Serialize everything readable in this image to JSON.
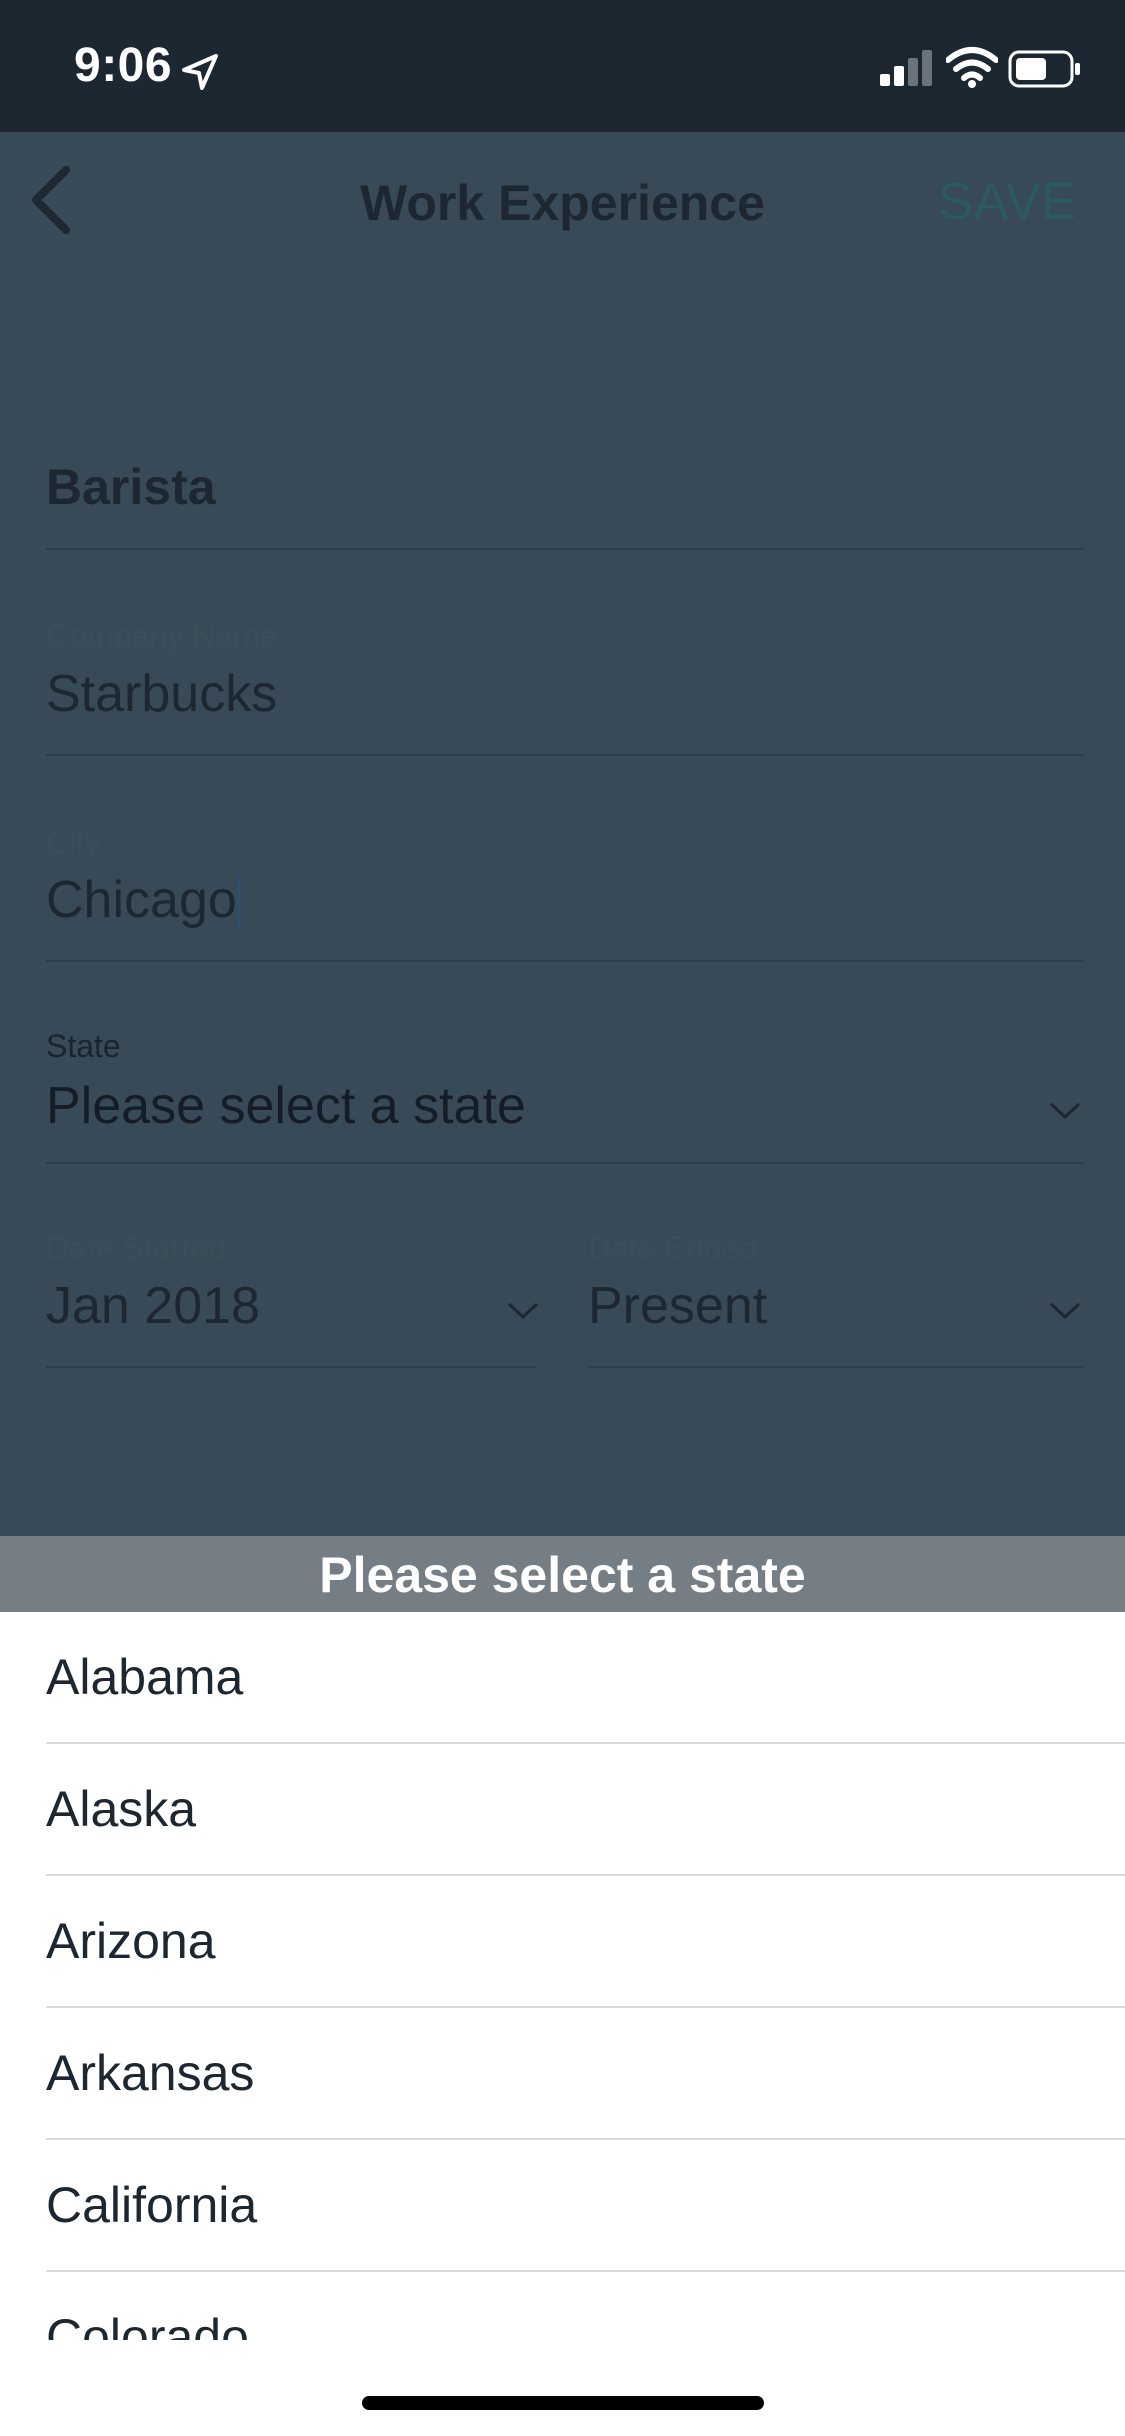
{
  "status_bar": {
    "time": "9:06"
  },
  "header": {
    "title": "Work Experience",
    "save_label": "SAVE"
  },
  "form": {
    "job_title": "Barista",
    "company_label": "Company Name",
    "company_value": "Starbucks",
    "city_label": "City",
    "city_value": "Chicago",
    "state_label": "State",
    "state_value": "Please select a state",
    "date_started_label": "Date Started",
    "date_started_value": "Jan 2018",
    "date_ended_label": "Date Ended",
    "date_ended_value": "Present"
  },
  "picker": {
    "title": "Please select a state",
    "options": [
      "Alabama",
      "Alaska",
      "Arizona",
      "Arkansas",
      "California",
      "Colorado"
    ]
  },
  "colors": {
    "status_bar_bg": "#1d2731",
    "overlay_bg": "#384a57",
    "sheet_header_bg": "#757e84",
    "save_accent": "#2b5b5e"
  }
}
